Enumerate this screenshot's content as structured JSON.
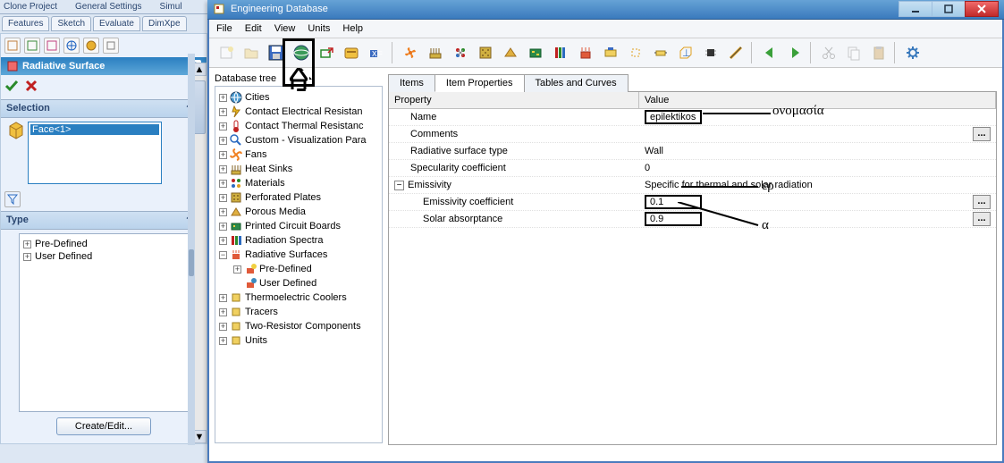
{
  "left": {
    "topbar": [
      "",
      "Clone Project",
      "",
      "General Settings",
      "",
      "Simul"
    ],
    "tabs": [
      "Features",
      "Sketch",
      "Evaluate",
      "DimXpe"
    ],
    "panel_title": "Radiative Surface",
    "help_mark": "?",
    "section_selection": "Selection",
    "face_selected": "Face<1>",
    "section_type": "Type",
    "type_items": [
      "Pre-Defined",
      "User Defined"
    ],
    "create_btn": "Create/Edit..."
  },
  "eng": {
    "title": "Engineering Database",
    "menus": [
      "File",
      "Edit",
      "View",
      "Units",
      "Help"
    ],
    "dbtree_label": "Database tree",
    "tree": [
      {
        "plus": "+",
        "icon": "globe",
        "label": "Cities"
      },
      {
        "plus": "+",
        "icon": "bolt",
        "label": "Contact Electrical Resistan"
      },
      {
        "plus": "+",
        "icon": "thermo",
        "label": "Contact Thermal Resistanc"
      },
      {
        "plus": "+",
        "icon": "magnify",
        "label": "Custom - Visualization Para"
      },
      {
        "plus": "+",
        "icon": "fan",
        "label": "Fans"
      },
      {
        "plus": "+",
        "icon": "bars",
        "label": "Heat Sinks"
      },
      {
        "plus": "+",
        "icon": "mat",
        "label": "Materials"
      },
      {
        "plus": "+",
        "icon": "grid",
        "label": "Perforated Plates"
      },
      {
        "plus": "+",
        "icon": "porous",
        "label": "Porous Media"
      },
      {
        "plus": "+",
        "icon": "pcb",
        "label": "Printed Circuit Boards"
      },
      {
        "plus": "+",
        "icon": "spectrum",
        "label": "Radiation Spectra"
      }
    ],
    "tree_open": {
      "label": "Radiative Surfaces",
      "children": [
        "Pre-Defined",
        "User Defined"
      ]
    },
    "tree_after": [
      {
        "label": "Thermoelectric Coolers"
      },
      {
        "label": "Tracers"
      },
      {
        "label": "Two-Resistor Components"
      },
      {
        "label": "Units"
      }
    ],
    "tabs": [
      "Items",
      "Item Properties",
      "Tables and Curves"
    ],
    "active_tab": 1,
    "prop_header": [
      "Property",
      "Value"
    ],
    "props": [
      {
        "name": "Name",
        "value": "epilektikos",
        "boxed": true,
        "dots": false
      },
      {
        "name": "Comments",
        "value": "",
        "boxed": false,
        "dots": true
      },
      {
        "name": "Radiative surface type",
        "value": "Wall",
        "boxed": false,
        "dots": false
      },
      {
        "name": "Specularity coefficient",
        "value": "0",
        "boxed": false,
        "dots": false
      }
    ],
    "group_label": "Emissivity",
    "group_value": "Specific for thermal and solar radiation",
    "group_children": [
      {
        "name": "Emissivity coefficient",
        "value": "0.1",
        "boxed": true,
        "dots": true
      },
      {
        "name": "Solar absorptance",
        "value": "0.9",
        "boxed": true,
        "dots": true
      }
    ]
  },
  "annotations": {
    "name": "ονομασία",
    "er": "ερ",
    "alpha": "α"
  }
}
